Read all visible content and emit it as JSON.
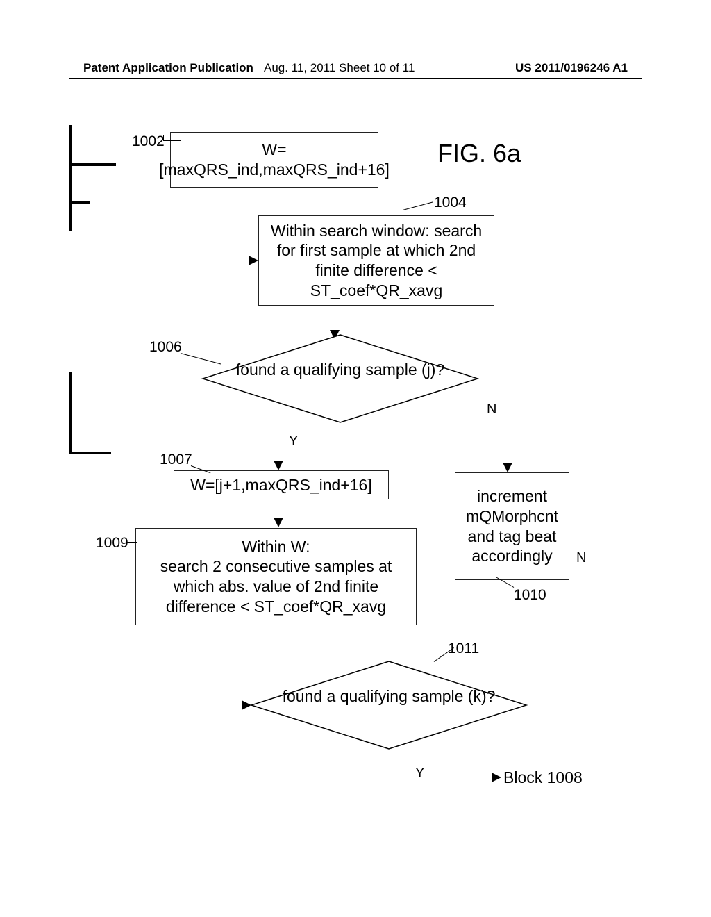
{
  "header": {
    "left": "Patent Application Publication",
    "mid": "Aug. 11, 2011  Sheet 10 of 11",
    "right": "US 2011/0196246 A1"
  },
  "fig_title": "FIG. 6a",
  "refs": {
    "r1002": "1002",
    "r1004": "1004",
    "r1006": "1006",
    "r1007": "1007",
    "r1009": "1009",
    "r1010": "1010",
    "r1011": "1011"
  },
  "boxes": {
    "b1002": "W=[maxQRS_ind,maxQRS_ind+16]",
    "b1004": "Within search window: search for first sample at which 2nd finite difference < ST_coef*QR_xavg",
    "b1007": "W=[j+1,maxQRS_ind+16]",
    "b1009": "Within W:\nsearch 2 consecutive  samples at which abs. value of 2nd finite difference < ST_coef*QR_xavg",
    "b1010": "increment mQMorphcnt and tag beat accordingly"
  },
  "diamonds": {
    "d1006": "found a qualifying sample (j)?",
    "d1011": "found a qualifying sample (k)?"
  },
  "labels": {
    "Y": "Y",
    "N": "N",
    "block1008": "Block 1008"
  }
}
